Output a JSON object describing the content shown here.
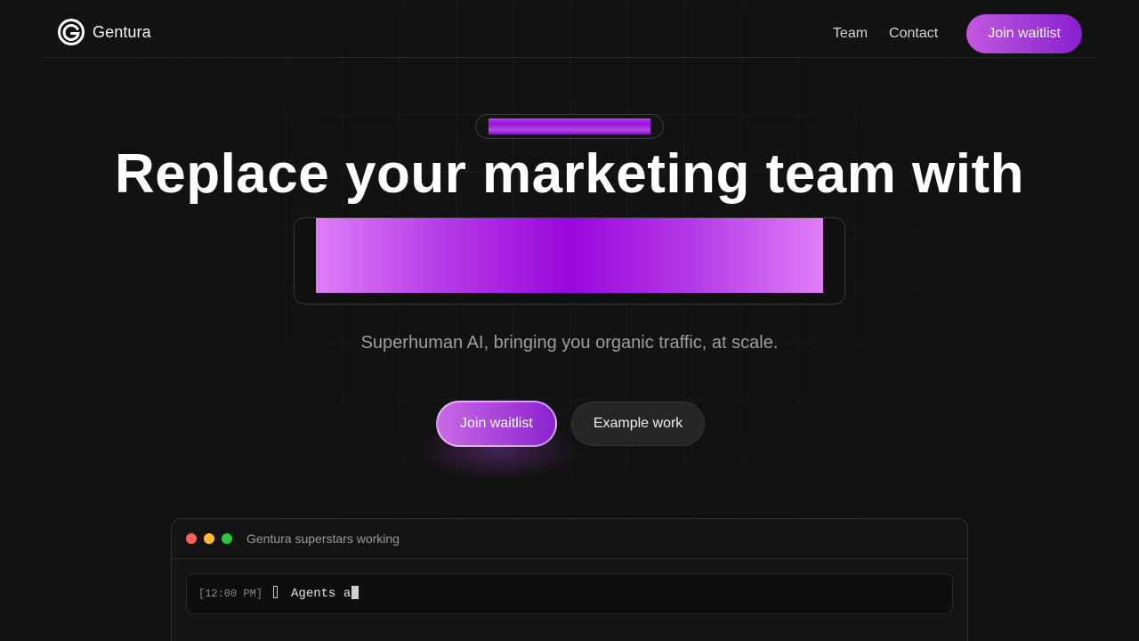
{
  "nav": {
    "brand_name": "Gentura",
    "logo_icon": "gentura-g-logo",
    "links": [
      {
        "label": "Team"
      },
      {
        "label": "Contact"
      }
    ],
    "cta_label": "Join waitlist"
  },
  "hero": {
    "title": "Replace your marketing team with",
    "subtitle": "Superhuman AI, bringing you organic traffic, at scale.",
    "primary_cta": "Join waitlist",
    "secondary_cta": "Example work"
  },
  "terminal": {
    "title": "Gentura superstars working",
    "window_dots": [
      "#ff5f57",
      "#febc2e",
      "#28c840"
    ],
    "log": {
      "time": "[12:00 PM]",
      "text": "Agents a"
    }
  },
  "colors": {
    "background": "#121212",
    "accent_start": "#c457e0",
    "accent_end": "#8b1fd0",
    "highlight_center": "#9a06dc",
    "highlight_edge": "#e07df7"
  }
}
